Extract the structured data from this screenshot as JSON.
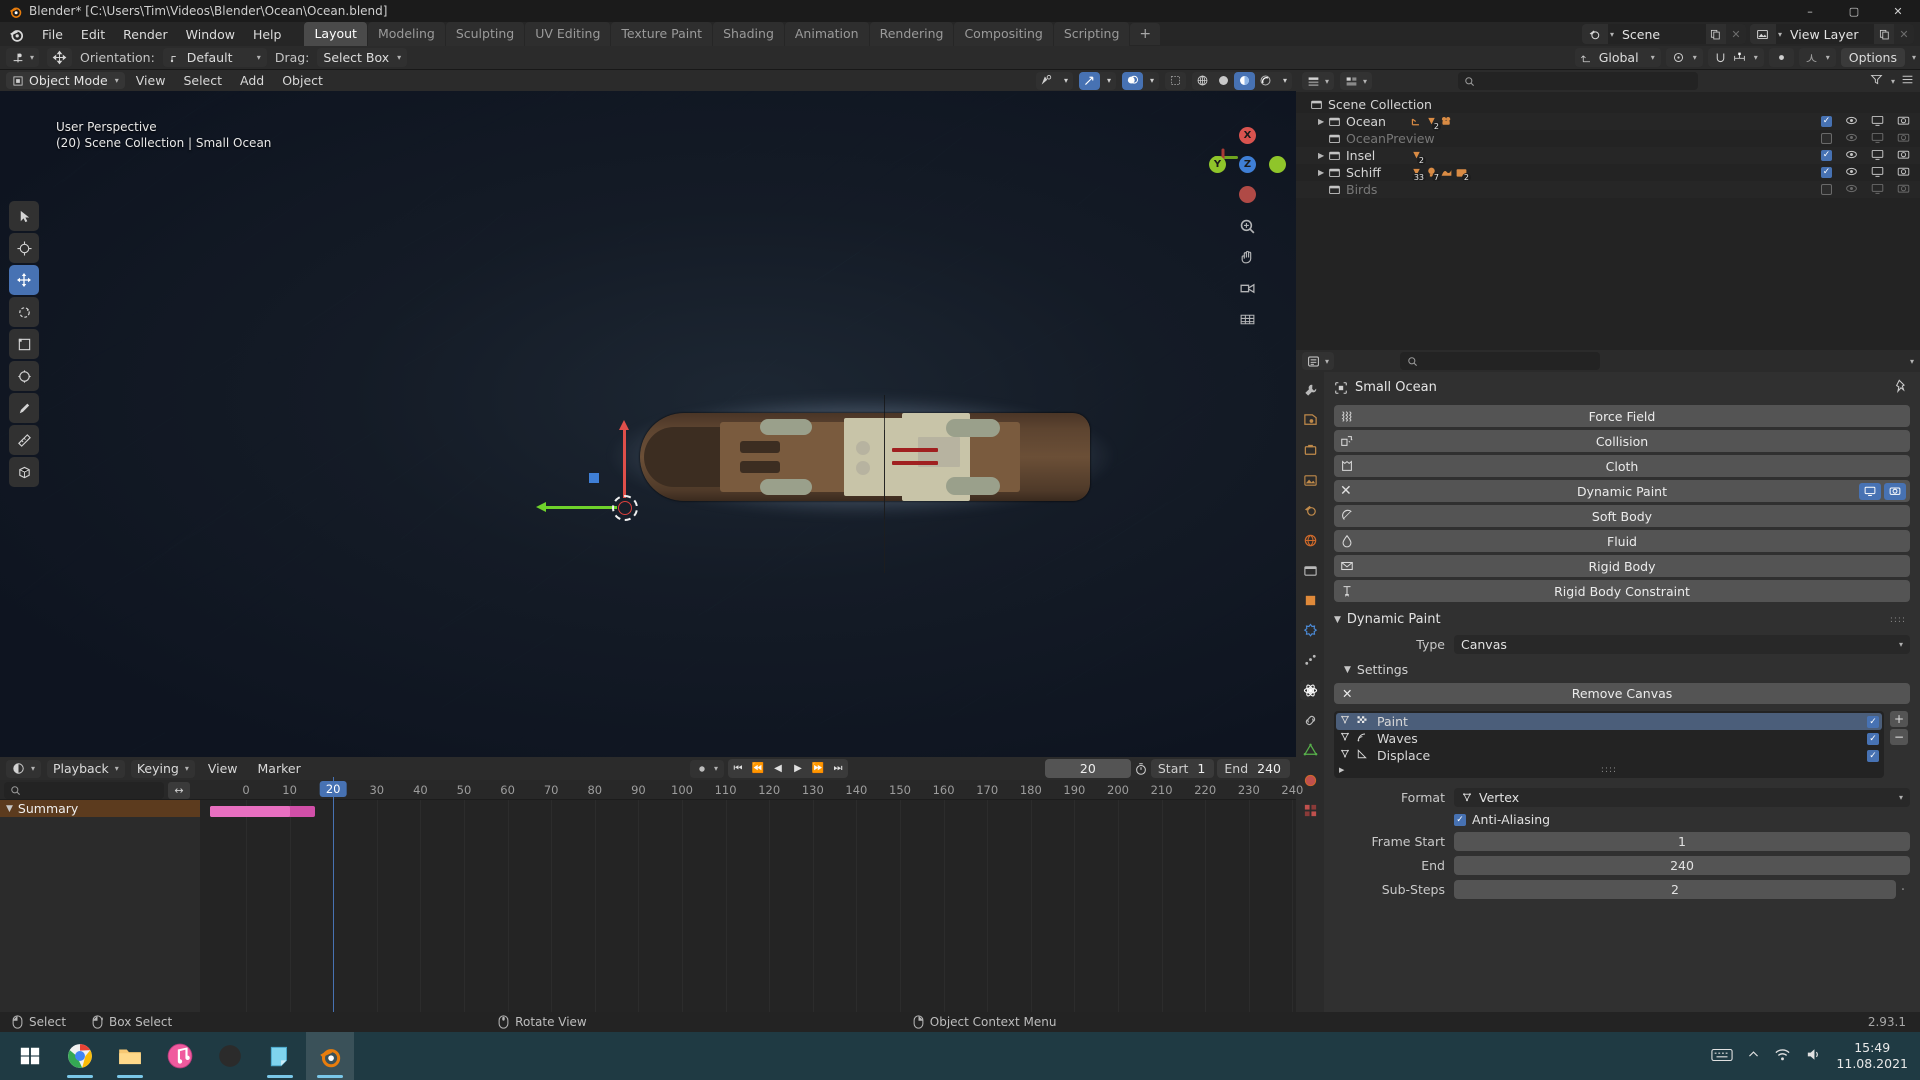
{
  "window": {
    "title": "Blender* [C:\\Users\\Tim\\Videos\\Blender\\Ocean\\Ocean.blend]",
    "minimize": "–",
    "maximize": "▢",
    "close": "✕"
  },
  "topbar": {
    "menus": [
      "File",
      "Edit",
      "Render",
      "Window",
      "Help"
    ],
    "workspaces": [
      "Layout",
      "Modeling",
      "Sculpting",
      "UV Editing",
      "Texture Paint",
      "Shading",
      "Animation",
      "Rendering",
      "Compositing",
      "Scripting"
    ],
    "active_workspace": "Layout",
    "add_workspace": "+",
    "scene_name": "Scene",
    "view_layer_name": "View Layer"
  },
  "toolsettings": {
    "orientation_label": "Orientation:",
    "orientation_value": "Default",
    "drag_label": "Drag:",
    "drag_value": "Select Box",
    "transform_orientation": "Global",
    "options_label": "Options"
  },
  "viewport": {
    "mode": "Object Mode",
    "menus": [
      "View",
      "Select",
      "Add",
      "Object"
    ],
    "overlay_line1": "User Perspective",
    "overlay_line2": "(20) Scene Collection | Small Ocean",
    "gizmo_axes": {
      "x": "X",
      "y": "Y",
      "z": "Z"
    },
    "tools": [
      "tweak-select-tool",
      "cursor-tool",
      "move-tool",
      "rotate-tool",
      "scale-tool",
      "transform-tool",
      "annotate-tool",
      "measure-tool",
      "add-cube-tool"
    ],
    "active_tool": "move-tool"
  },
  "outliner": {
    "search_placeholder": "",
    "rows": [
      {
        "name": "Scene Collection",
        "indent": 0,
        "icon": "collection-icon",
        "expandable": false,
        "dimmed": false,
        "checkbox": null,
        "badges": []
      },
      {
        "name": "Ocean",
        "indent": 1,
        "icon": "collection-icon",
        "expandable": true,
        "dimmed": false,
        "checkbox": true,
        "badges": [
          {
            "type": "empty-icon",
            "count": ""
          },
          {
            "type": "mesh-icon",
            "count": "2"
          },
          {
            "type": "camera-icon",
            "count": ""
          }
        ]
      },
      {
        "name": "OceanPreview",
        "indent": 1,
        "icon": "collection-icon",
        "expandable": false,
        "dimmed": true,
        "checkbox": false,
        "badges": []
      },
      {
        "name": "Insel",
        "indent": 1,
        "icon": "collection-icon",
        "expandable": true,
        "dimmed": false,
        "checkbox": true,
        "badges": [
          {
            "type": "mesh-icon",
            "count": "2"
          }
        ]
      },
      {
        "name": "Schiff",
        "indent": 1,
        "icon": "collection-icon",
        "expandable": true,
        "dimmed": false,
        "checkbox": true,
        "badges": [
          {
            "type": "mesh-icon",
            "count": "33"
          },
          {
            "type": "light-icon",
            "count": "7"
          },
          {
            "type": "material-icon",
            "count": ""
          },
          {
            "type": "collection-icon",
            "count": "2"
          }
        ]
      },
      {
        "name": "Birds",
        "indent": 1,
        "icon": "collection-icon",
        "expandable": false,
        "dimmed": true,
        "checkbox": false,
        "badges": []
      }
    ]
  },
  "properties": {
    "search_placeholder": "",
    "object_name": "Small Ocean",
    "physics_buttons": [
      {
        "label": "Force Field",
        "icon": "force-field-icon",
        "enabled": false
      },
      {
        "label": "Collision",
        "icon": "collision-icon",
        "enabled": false
      },
      {
        "label": "Cloth",
        "icon": "cloth-icon",
        "enabled": false
      },
      {
        "label": "Dynamic Paint",
        "icon": "close-icon",
        "enabled": true
      },
      {
        "label": "Soft Body",
        "icon": "soft-body-icon",
        "enabled": false
      },
      {
        "label": "Fluid",
        "icon": "fluid-icon",
        "enabled": false
      },
      {
        "label": "Rigid Body",
        "icon": "rigid-body-icon",
        "enabled": false
      },
      {
        "label": "Rigid Body Constraint",
        "icon": "rigid-body-constraint-icon",
        "enabled": false
      }
    ],
    "dynamic_paint": {
      "panel_title": "Dynamic Paint",
      "type_label": "Type",
      "type_value": "Canvas",
      "settings_label": "Settings",
      "remove_canvas_label": "Remove Canvas",
      "surfaces": [
        {
          "name": "Paint",
          "icon": "paint-surface-icon",
          "checked": true,
          "selected": true
        },
        {
          "name": "Waves",
          "icon": "waves-surface-icon",
          "checked": true,
          "selected": false
        },
        {
          "name": "Displace",
          "icon": "displace-surface-icon",
          "checked": true,
          "selected": false
        }
      ],
      "format_label": "Format",
      "format_value": "Vertex",
      "antialiasing_label": "Anti-Aliasing",
      "antialiasing_checked": true,
      "frame_start_label": "Frame Start",
      "frame_start_value": "1",
      "end_label": "End",
      "end_value": "240",
      "substeps_label": "Sub-Steps",
      "substeps_value": "2"
    }
  },
  "timeline": {
    "editor_menu": "timeline-editor-icon",
    "menus": [
      "Playback",
      "Keying",
      "View",
      "Marker"
    ],
    "current_frame": "20",
    "start_label": "Start",
    "start_value": "1",
    "end_label": "End",
    "end_value": "240",
    "ruler_ticks": [
      "0",
      "10",
      "20",
      "30",
      "40",
      "50",
      "60",
      "70",
      "80",
      "90",
      "100",
      "110",
      "120",
      "130",
      "140",
      "150",
      "160",
      "170",
      "180",
      "190",
      "200",
      "210",
      "220",
      "230",
      "240"
    ],
    "playhead_frame": "20",
    "summary_label": "Summary",
    "search_placeholder": ""
  },
  "statusbar": {
    "items": [
      {
        "icon": "mouse-left-icon",
        "label": "Select"
      },
      {
        "icon": "mouse-drag-icon",
        "label": "Box Select"
      },
      {
        "icon": "mouse-middle-icon",
        "label": "Rotate View"
      },
      {
        "icon": "mouse-right-icon",
        "label": "Object Context Menu"
      }
    ],
    "version": "2.93.1"
  },
  "taskbar": {
    "apps": [
      "start-icon",
      "chrome-icon",
      "file-explorer-icon",
      "itunes-icon",
      "audio-app-icon",
      "sticky-notes-icon",
      "blender-icon"
    ],
    "active_app": "blender-icon",
    "clock_time": "15:49",
    "clock_date": "11.08.2021",
    "tray_icons": [
      "keyboard-icon",
      "chevron-up-icon",
      "network-icon",
      "volume-icon"
    ]
  },
  "colors": {
    "accent_blue": "#4772b3",
    "axis_x_red": "#e04f4a",
    "axis_y_green": "#6fd22b",
    "axis_z_blue": "#3f7fd6",
    "summary_orange": "#5c3b1e",
    "keyframe_pink": "#d14fa8"
  }
}
